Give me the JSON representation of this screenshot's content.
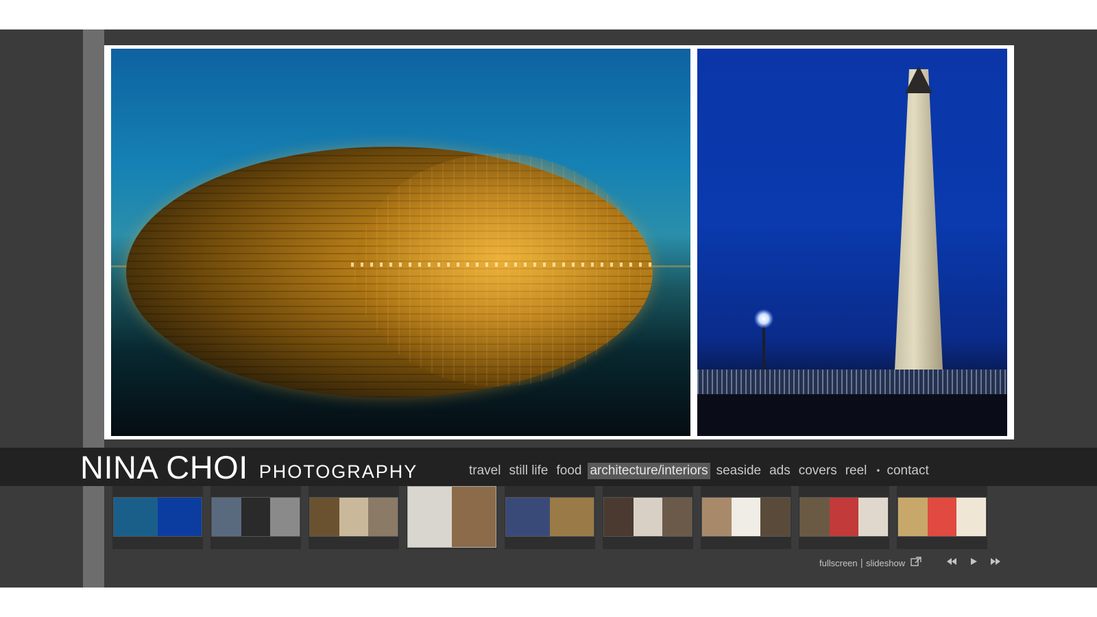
{
  "brand": {
    "name": "NINA CHOI",
    "sub": "PHOTOGRAPHY"
  },
  "nav": {
    "items": [
      {
        "label": "travel",
        "active": false
      },
      {
        "label": "still life",
        "active": false
      },
      {
        "label": "food",
        "active": false
      },
      {
        "label": "architecture/interiors",
        "active": true
      },
      {
        "label": "seaside",
        "active": false
      },
      {
        "label": "ads",
        "active": false
      },
      {
        "label": "covers",
        "active": false
      },
      {
        "label": "reel",
        "active": false
      }
    ],
    "separator": "•",
    "contact": "contact"
  },
  "thumbnails": [
    {
      "selected": false,
      "colors": [
        "#1a5f8a",
        "#0b3da0"
      ]
    },
    {
      "selected": false,
      "colors": [
        "#5a6a7e",
        "#2a2a2a",
        "#8a8a8a"
      ]
    },
    {
      "selected": false,
      "colors": [
        "#6a5230",
        "#c9b99a",
        "#8a7a66"
      ]
    },
    {
      "selected": true,
      "colors": [
        "#d9d6cf",
        "#8b6b4a"
      ]
    },
    {
      "selected": false,
      "colors": [
        "#3a4a78",
        "#9a7a46"
      ]
    },
    {
      "selected": false,
      "colors": [
        "#4a3a30",
        "#d8d0c4",
        "#6b5a4a"
      ]
    },
    {
      "selected": false,
      "colors": [
        "#a88a6a",
        "#f0ece6",
        "#5a4a3a"
      ]
    },
    {
      "selected": false,
      "colors": [
        "#6a5a44",
        "#c23a3a",
        "#e0d8cc"
      ]
    },
    {
      "selected": false,
      "colors": [
        "#c8a86a",
        "#e04a40",
        "#f0e6d6"
      ]
    }
  ],
  "controls": {
    "fullscreen": "fullscreen",
    "divider": "|",
    "slideshow": "slideshow",
    "icons": [
      "external-link-icon",
      "rewind-icon",
      "play-icon",
      "fast-forward-icon"
    ]
  }
}
